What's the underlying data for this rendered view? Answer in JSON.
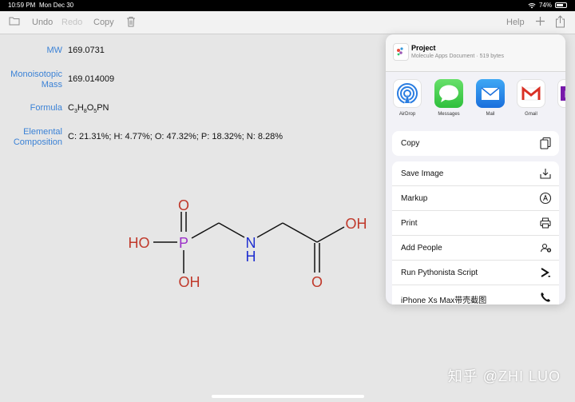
{
  "status_bar": {
    "time": "10:59 PM",
    "date": "Mon Dec 30",
    "battery": "74%",
    "battery_level": 0.74
  },
  "toolbar": {
    "undo": "Undo",
    "redo": "Redo",
    "copy": "Copy",
    "help": "Help"
  },
  "properties": [
    {
      "label": "MW",
      "value": "169.0731"
    },
    {
      "label": "Monoisotopic Mass",
      "value": "169.014009"
    },
    {
      "label": "Formula",
      "value": "C3H8O5PN"
    },
    {
      "label": "Elemental Composition",
      "value": "C: 21.31%; H: 4.77%; O: 47.32%; P: 18.32%; N: 8.28%"
    }
  ],
  "formula_parts": {
    "c": "C",
    "c_sub": "3",
    "h": "H",
    "h_sub": "8",
    "o": "O",
    "o_sub": "5",
    "rest": "PN"
  },
  "molecule": {
    "o_top": "O",
    "ho_left": "HO",
    "p": "P",
    "oh_bottom": "OH",
    "n": "N",
    "h": "H",
    "oh_right": "OH",
    "o_bottom": "O"
  },
  "share_sheet": {
    "title": "Project",
    "subtitle": "Molecule Apps Document · 519 bytes",
    "apps": [
      {
        "label": "AirDrop",
        "icon": "airdrop-icon"
      },
      {
        "label": "Messages",
        "icon": "messages-icon"
      },
      {
        "label": "Mail",
        "icon": "mail-icon"
      },
      {
        "label": "Gmail",
        "icon": "gmail-icon"
      },
      {
        "label": "O",
        "icon": "onenote-icon"
      }
    ],
    "actions_group1": [
      {
        "label": "Copy",
        "icon": "copy-icon"
      }
    ],
    "actions_group2": [
      {
        "label": "Save Image",
        "icon": "save-image-icon"
      },
      {
        "label": "Markup",
        "icon": "markup-icon"
      },
      {
        "label": "Print",
        "icon": "print-icon"
      },
      {
        "label": "Add People",
        "icon": "add-people-icon"
      },
      {
        "label": "Run Pythonista Script",
        "icon": "pythonista-icon"
      },
      {
        "label": "iPhone Xs Max带壳截图",
        "icon": "phone-icon"
      }
    ]
  },
  "watermark": "知乎 @ZHI LUO",
  "colors": {
    "accent": "#3b82d6",
    "oxygen": "#c0392b",
    "nitrogen": "#1f2fd0",
    "phosphorus": "#9b30c8"
  }
}
